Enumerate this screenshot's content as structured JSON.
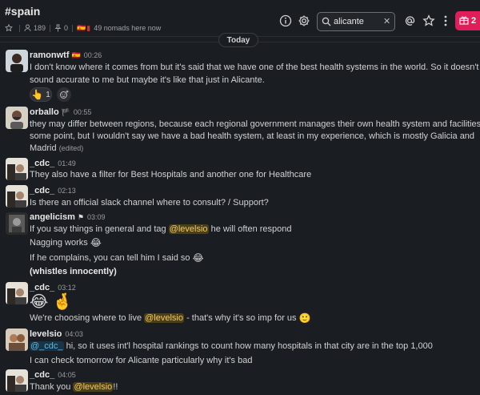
{
  "channel": {
    "title": "#spain",
    "members_count": "189",
    "pinned_count": "0",
    "nomads_text": "49 nomads here now"
  },
  "search": {
    "value": "alicante"
  },
  "notifications": {
    "gift_count": "2"
  },
  "day_divider": "Today",
  "colors": {
    "background": "#1a1d21",
    "mention_bg": "#4a3f16",
    "mention_fg": "#f3c969",
    "link_blue": "#5fb6e3",
    "gift_red": "#e01e5a"
  },
  "messages": [
    {
      "user": "ramonwtf",
      "flag": "🇪🇸",
      "time": "00:26",
      "lines": [
        "I don't know where it comes from but it's said that we have one of the best health systems in the world. So it doesn't",
        "sound accurate to me but maybe it's like that just in Alicante."
      ],
      "reaction": {
        "emoji": "👆",
        "count": "1"
      }
    },
    {
      "user": "orballo",
      "flag": "🏴",
      "time": "00:55",
      "lines": [
        "they may differ between regions, because each regional government manages their own health system and facilities to",
        "some point, but I wouldn't say we have a bad health system, at least in my experience, which is mostly Galicia and",
        "Madrid"
      ],
      "edited": "(edited)"
    },
    {
      "user": "_cdc_",
      "time": "01:49",
      "lines": [
        "They also have a filter for Best Hospitals and another one for Healthcare"
      ]
    },
    {
      "user": "_cdc_",
      "time": "02:13",
      "lines": [
        "Is there an official slack channel where to consult? / Support?"
      ]
    },
    {
      "user": "angelicism",
      "time": "03:09",
      "line1_pre": "If you say things in general and tag",
      "mention": "@levelsio",
      "line1_post": "he will often respond",
      "line2": "Nagging works",
      "line3": "If he complains, you can tell him I said so",
      "line4": "(whistles innocently)"
    },
    {
      "user": "_cdc_",
      "time": "03:12",
      "emojis": "😂 🤞",
      "line_pre": "We're choosing where to live",
      "mention": "@levelsio",
      "line_post": "- that's why it's so imp for us"
    },
    {
      "user": "levelsio",
      "time": "04:03",
      "mention": "@_cdc_",
      "line1_post": "hi, so it uses int'l hospital rankings to count how many hospitals in that city are in the top 1,000",
      "line2": "I can check tomorrow for Alicante particularly why it's bad"
    },
    {
      "user": "_cdc_",
      "time": "04:05",
      "line_pre": "Thank you",
      "mention": "@levelsio",
      "line_post": "!!"
    }
  ]
}
